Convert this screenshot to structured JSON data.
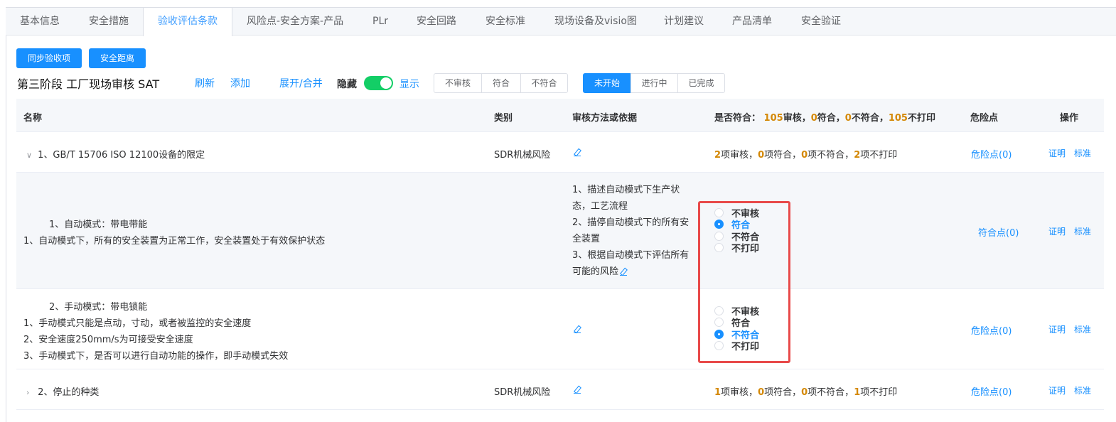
{
  "tabs": [
    "基本信息",
    "安全措施",
    "验收评估条款",
    "风险点-安全方案-产品",
    "PLr",
    "安全回路",
    "安全标准",
    "现场设备及visio图",
    "计划建议",
    "产品清单",
    "安全验证"
  ],
  "active_tab": "验收评估条款",
  "toolbar": {
    "sync_button": "同步验收项",
    "distance_button": "安全距离",
    "stage_title": "第三阶段 工厂现场审核 SAT",
    "refresh": "刷新",
    "add": "添加",
    "expand_collapse": "展开/合并",
    "hide_label": "隐藏",
    "show_label": "显示",
    "hide_switch_on": true,
    "filter_audit": [
      "不审核",
      "符合",
      "不符合"
    ],
    "filter_status": [
      "未开始",
      "进行中",
      "已完成"
    ],
    "filter_status_selected": "未开始"
  },
  "table": {
    "headers": {
      "name": "名称",
      "category": "类别",
      "method": "审核方法或依据",
      "conform_prefix": "是否符合：",
      "summary": [
        {
          "n": "105",
          "t": "审核，"
        },
        {
          "n": "0",
          "t": "符合，"
        },
        {
          "n": "0",
          "t": "不符合，"
        },
        {
          "n": "105",
          "t": "不打印"
        }
      ],
      "hazard": "危险点",
      "ops": "操作"
    },
    "group1": {
      "title": "1、GB/T 15706 ISO 12100设备的限定",
      "category": "SDR机械风险",
      "stats": [
        {
          "n": "2",
          "t": "项审核，"
        },
        {
          "n": "0",
          "t": "项符合，"
        },
        {
          "n": "0",
          "t": "项不符合，"
        },
        {
          "n": "2",
          "t": "项不打印"
        }
      ],
      "hazard": "危险点(0)",
      "proof": "证明",
      "standard": "标准"
    },
    "item1": {
      "title": "1、自动模式：带电带能",
      "desc": "1、自动模式下，所有的安全装置为正常工作，安全装置处于有效保护状态",
      "method_lines": [
        "1、描述自动模式下生产状",
        "态，工艺流程",
        "2、描停自动模式下的所有安",
        "全装置",
        "3、根据自动模式下评估所有",
        "可能的风险"
      ],
      "options": [
        "不审核",
        "符合",
        "不符合",
        "不打印"
      ],
      "selected": 1,
      "hazard": "符合点(0)",
      "proof": "证明",
      "standard": "标准"
    },
    "item2": {
      "title": "2、手动模式：带电锁能",
      "desc_lines": [
        "1、手动模式只能是点动，寸动，或者被监控的安全速度",
        "2、安全速度250mm/s为可接受安全速度",
        "3、手动模式下，是否可以进行自动功能的操作，即手动模式失效"
      ],
      "options": [
        "不审核",
        "符合",
        "不符合",
        "不打印"
      ],
      "selected": 2,
      "hazard": "危险点(0)",
      "proof": "证明",
      "standard": "标准"
    },
    "group2": {
      "title": "2、停止的种类",
      "category": "SDR机械风险",
      "stats": [
        {
          "n": "1",
          "t": "项审核，"
        },
        {
          "n": "0",
          "t": "项符合，"
        },
        {
          "n": "0",
          "t": "项不符合，"
        },
        {
          "n": "1",
          "t": "项不打印"
        }
      ],
      "hazard": "危险点(0)",
      "proof": "证明",
      "standard": "标准"
    }
  },
  "colors": {
    "primary": "#1890ff",
    "accent_number": "#d48806",
    "switch_on": "#13ce66",
    "highlight": "#e84a4a"
  }
}
